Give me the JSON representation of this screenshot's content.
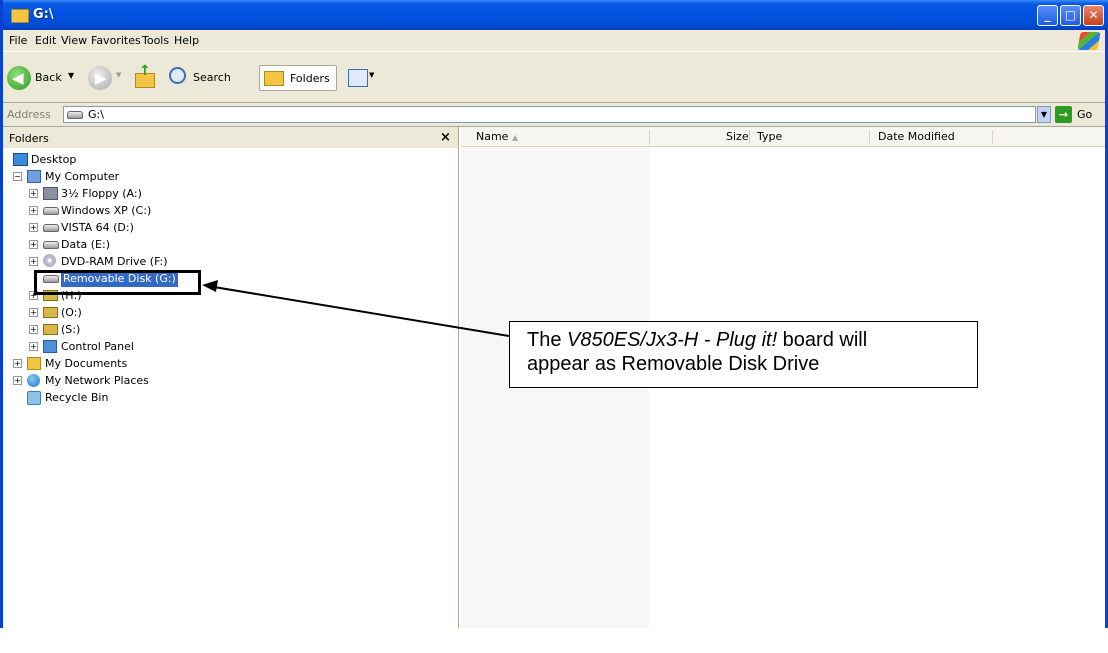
{
  "window": {
    "title": "G:\\"
  },
  "menu": [
    "File",
    "Edit",
    "View",
    "Favorites",
    "Tools",
    "Help"
  ],
  "toolbar": {
    "back": "Back",
    "search": "Search",
    "folders": "Folders"
  },
  "address": {
    "label": "Address",
    "value": "G:\\",
    "go": "Go"
  },
  "folders_pane": {
    "title": "Folders",
    "close": "×"
  },
  "tree": {
    "desktop": "Desktop",
    "my_computer": "My Computer",
    "floppy": "3½ Floppy (A:)",
    "c": "Windows XP (C:)",
    "d": "VISTA 64 (D:)",
    "e": "Data (E:)",
    "f": "DVD-RAM Drive (F:)",
    "g": "Removable Disk (G:)",
    "h": "(H:)",
    "o": "(O:)",
    "s": "(S:)",
    "control_panel": "Control Panel",
    "my_documents": "My Documents",
    "network": "My Network Places",
    "recycle": "Recycle Bin"
  },
  "columns": {
    "name": "Name",
    "size": "Size",
    "type": "Type",
    "date": "Date Modified"
  },
  "callout": {
    "pre": "The ",
    "board": "V850ES/Jx3-H - Plug it!",
    "post": " board will",
    "line2": "appear as Removable Disk Drive"
  }
}
